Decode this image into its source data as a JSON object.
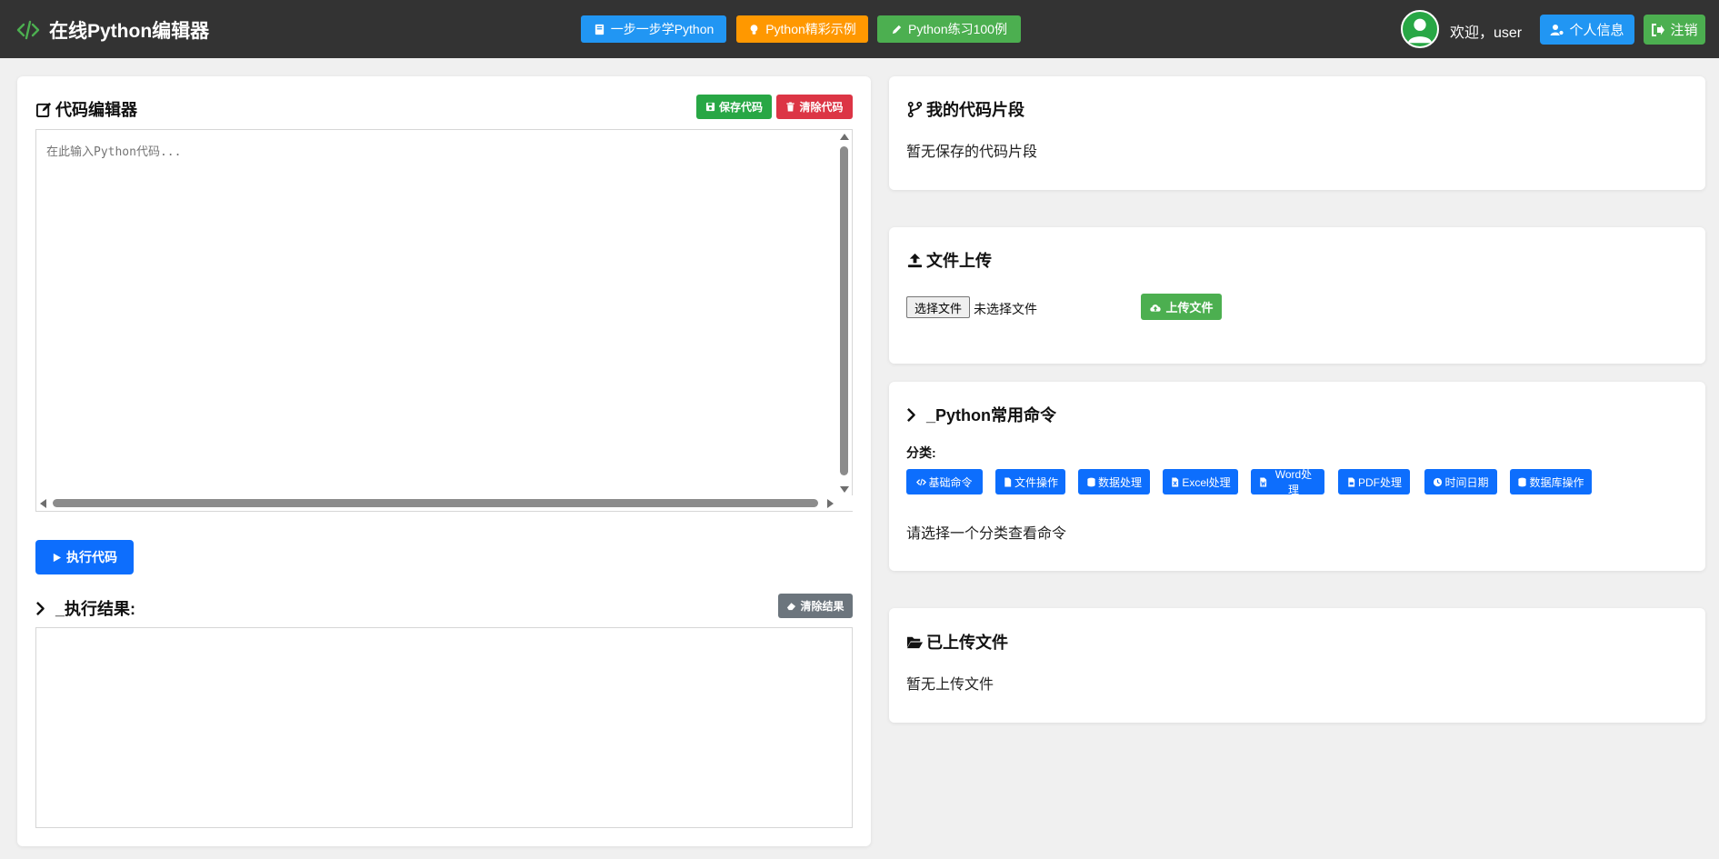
{
  "header": {
    "brand_title": "在线Python编辑器",
    "nav": [
      {
        "label": "一步一步学Python",
        "color": "#2196f3",
        "icon": "book-icon"
      },
      {
        "label": "Python精彩示例",
        "color": "#ff9800",
        "icon": "lightbulb-icon"
      },
      {
        "label": "Python练习100例",
        "color": "#4caf50",
        "icon": "pencil-icon"
      }
    ],
    "welcome_text": "欢迎，user",
    "profile_label": "个人信息",
    "logout_label": "注销"
  },
  "editor_panel": {
    "title": "代码编辑器",
    "save_label": "保存代码",
    "clear_label": "清除代码",
    "code_placeholder": "在此输入Python代码...",
    "run_label": "执行代码",
    "result_title": "_执行结果:",
    "clear_result_label": "清除结果"
  },
  "snippets": {
    "title": "我的代码片段",
    "empty_text": "暂无保存的代码片段"
  },
  "upload": {
    "title": "文件上传",
    "choose_label": "选择文件",
    "no_file_text": "未选择文件",
    "upload_label": "上传文件"
  },
  "commands": {
    "title": "_Python常用命令",
    "category_label": "分类:",
    "categories": [
      {
        "label": "基础命令",
        "icon": "code-icon"
      },
      {
        "label": "文件操作",
        "icon": "file-icon"
      },
      {
        "label": "数据处理",
        "icon": "database-icon"
      },
      {
        "label": "Excel处理",
        "icon": "file-excel-icon"
      },
      {
        "label": "Word处理",
        "icon": "file-word-icon"
      },
      {
        "label": "PDF处理",
        "icon": "file-pdf-icon"
      },
      {
        "label": "时间日期",
        "icon": "clock-icon"
      },
      {
        "label": "数据库操作",
        "icon": "database-icon"
      }
    ],
    "hint_text": "请选择一个分类查看命令"
  },
  "uploaded": {
    "title": "已上传文件",
    "empty_text": "暂无上传文件"
  },
  "colors": {
    "header_bg": "#333333",
    "primary": "#0d6efd",
    "success": "#28a745",
    "danger": "#dc3545",
    "secondary": "#6c757d"
  }
}
